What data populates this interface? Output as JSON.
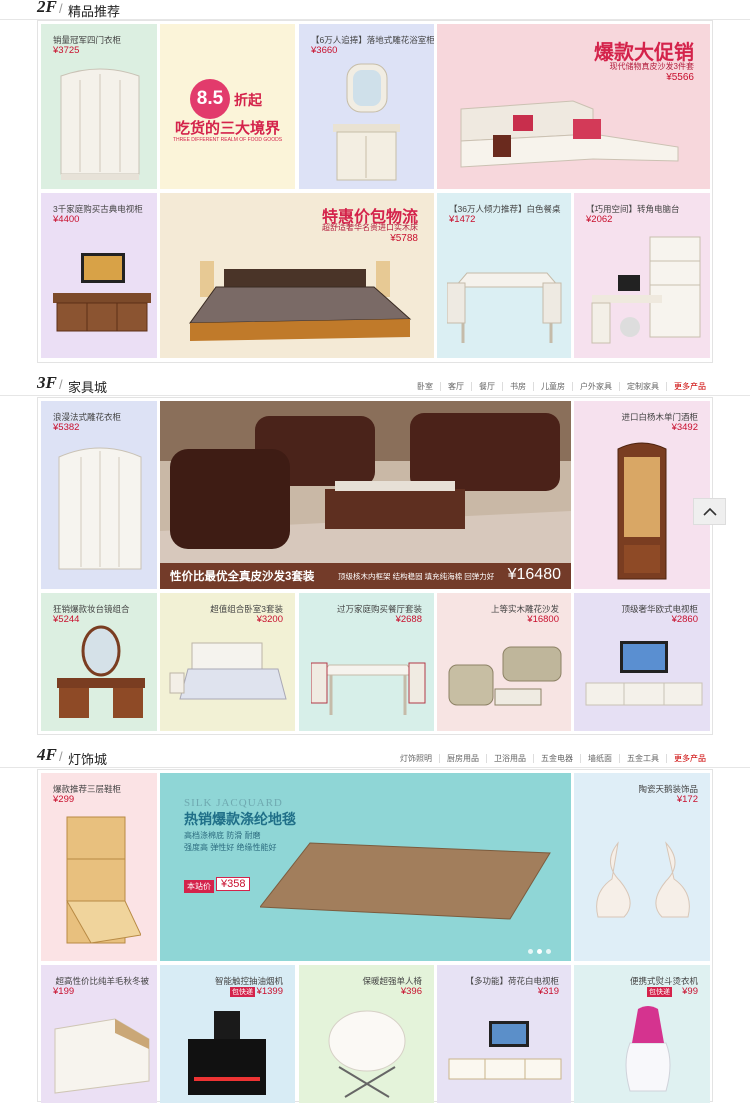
{
  "floors": [
    {
      "floor": "2F",
      "name": "精品推荐"
    },
    {
      "floor": "3F",
      "name": "家具城"
    },
    {
      "floor": "4F",
      "name": "灯饰城"
    }
  ],
  "f3_categories": [
    "卧室",
    "客厅",
    "餐厅",
    "书房",
    "儿童房",
    "户外家具",
    "定制家具",
    "更多产品"
  ],
  "f4_categories": [
    "灯饰照明",
    "厨房用品",
    "卫浴用品",
    "五金电器",
    "墙纸面",
    "五金工具",
    "更多产品"
  ],
  "f2": {
    "wardrobe": {
      "title": "销量冠军四门衣柜",
      "price": "¥3725"
    },
    "food": {
      "discount": "8.5",
      "discount_suffix": "折起",
      "headline": "吃货的三大境界",
      "sub": "THREE DIFFERENT REALM OF FOOD GOODS"
    },
    "bathroom": {
      "title": "【6万人追捧】落地式雕花浴室柜",
      "price": "¥3660"
    },
    "sofa_promo": {
      "headline": "爆款大促销",
      "sub": "现代储物真皮沙发3件套",
      "price": "¥5566"
    },
    "tvstand": {
      "title": "3千家庭购买古典电视柜",
      "price": "¥4400"
    },
    "bed_promo": {
      "headline": "特惠价包物流",
      "sub": "超舒适奢华名贵进口实木床",
      "price": "¥5788"
    },
    "dining": {
      "title": "【36万人倾力推荐】白色餐桌",
      "price": "¥1472"
    },
    "desk": {
      "title": "【巧用空间】转角电脑台",
      "price": "¥2062"
    }
  },
  "f3": {
    "wardrobe": {
      "title": "浪漫法式雕花衣柜",
      "price": "¥5382"
    },
    "banner": {
      "caption": "性价比最优全真皮沙发3套装",
      "features": "顶级核木内框架  结构稳固  填充纯海棉  回弹力好",
      "price": "¥16480"
    },
    "wine": {
      "title": "进口白杨木单门酒柜",
      "price": "¥3492"
    },
    "dresser": {
      "title": "狂销爆款妆台镜组合",
      "price": "¥5244"
    },
    "bedroom": {
      "title": "超值组合卧室3套装",
      "price": "¥3200"
    },
    "dining": {
      "title": "过万家庭购买餐厅套装",
      "price": "¥2688"
    },
    "sofa": {
      "title": "上等实木雕花沙发",
      "price": "¥16800"
    },
    "tv": {
      "title": "顶级奢华欧式电视柜",
      "price": "¥2860"
    }
  },
  "f4": {
    "shoe": {
      "title": "爆款推荐三层鞋柜",
      "price": "¥299"
    },
    "banner": {
      "en": "SILK JACQUARD",
      "headline": "热销爆款涤纶地毯",
      "bullets": [
        "高档涤棉底 防滑 耐磨",
        "强度高  弹性好  绝缘性能好"
      ],
      "tag": "本站价",
      "price": "¥358"
    },
    "swan": {
      "title": "陶瓷天鹅装饰品",
      "price": "¥172"
    },
    "quilt": {
      "title": "超高性价比纯羊毛秋冬被",
      "price": "¥199"
    },
    "hood": {
      "title": "智能触控抽油烟机",
      "tag": "包快递",
      "price": "¥1399"
    },
    "chair": {
      "title": "保暖超强单人椅",
      "price": "¥396"
    },
    "tvcab": {
      "title": "【多功能】荷花白电视柜",
      "price": "¥319"
    },
    "steamer": {
      "title": "便携式熨斗烫衣机",
      "tag": "包快递",
      "price": "¥99"
    }
  },
  "colors": {
    "price": "#c8102e",
    "brand_red": "#d4234b",
    "frame": "#e3e3e3"
  }
}
